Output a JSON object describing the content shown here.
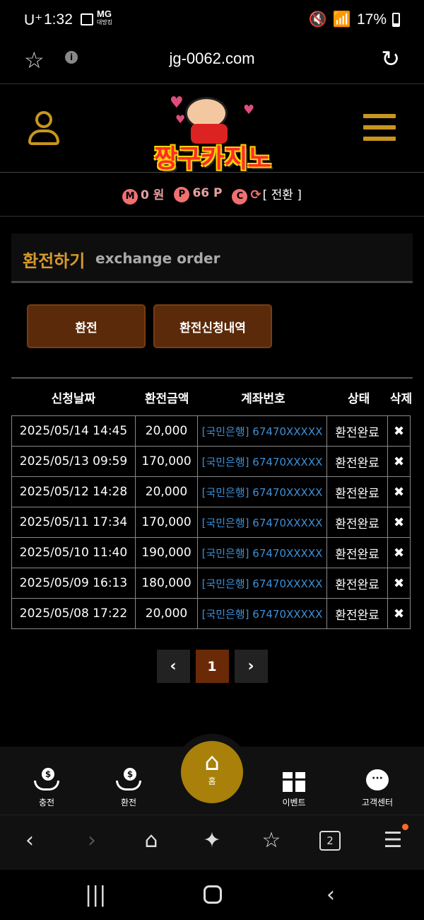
{
  "status_bar": {
    "carrier": "U⁺",
    "time": "1:32",
    "mg_label": "MG",
    "mg_sub": "대방킹",
    "battery": "17%"
  },
  "browser_bar": {
    "url": "jg-0062.com",
    "info_label": "i"
  },
  "header": {
    "logo_text": "짱구카지노"
  },
  "wallet": {
    "m_badge": "M",
    "m_value": "0 원",
    "p_badge": "P",
    "p_value": "66 P",
    "c_badge": "C",
    "convert_label": "[ 전환 ]"
  },
  "page": {
    "title_ko": "환전하기",
    "title_en": "exchange order"
  },
  "buttons": {
    "exchange": "환전",
    "history": "환전신청내역"
  },
  "table": {
    "headers": [
      "신청날짜",
      "환전금액",
      "계좌번호",
      "상태",
      "삭제"
    ],
    "rows": [
      {
        "date": "2025/05/14 14:45",
        "amount": "20,000",
        "account": "[국민은행] 67470XXXXX",
        "status": "환전완료",
        "del": "✖"
      },
      {
        "date": "2025/05/13 09:59",
        "amount": "170,000",
        "account": "[국민은행] 67470XXXXX",
        "status": "환전완료",
        "del": "✖"
      },
      {
        "date": "2025/05/12 14:28",
        "amount": "20,000",
        "account": "[국민은행] 67470XXXXX",
        "status": "환전완료",
        "del": "✖"
      },
      {
        "date": "2025/05/11 17:34",
        "amount": "170,000",
        "account": "[국민은행] 67470XXXXX",
        "status": "환전완료",
        "del": "✖"
      },
      {
        "date": "2025/05/10 11:40",
        "amount": "190,000",
        "account": "[국민은행] 67470XXXXX",
        "status": "환전완료",
        "del": "✖"
      },
      {
        "date": "2025/05/09 16:13",
        "amount": "180,000",
        "account": "[국민은행] 67470XXXXX",
        "status": "환전완료",
        "del": "✖"
      },
      {
        "date": "2025/05/08 17:22",
        "amount": "20,000",
        "account": "[국민은행] 67470XXXXX",
        "status": "환전완료",
        "del": "✖"
      }
    ]
  },
  "pagination": {
    "prev": "‹",
    "current": "1",
    "next": "›"
  },
  "bottom_nav": {
    "deposit": "충전",
    "withdraw": "환전",
    "home": "홈",
    "event": "이벤트",
    "support": "고객센터",
    "coin_symbol": "$",
    "chat_symbol": "···"
  },
  "browser_nav": {
    "tab_count": "2"
  },
  "colors": {
    "gold": "#c8961e",
    "title_gold": "#d79a2c",
    "button_brown": "#5a2a0a",
    "link_blue": "#3d8fd6",
    "home_gold": "#a8800a"
  }
}
